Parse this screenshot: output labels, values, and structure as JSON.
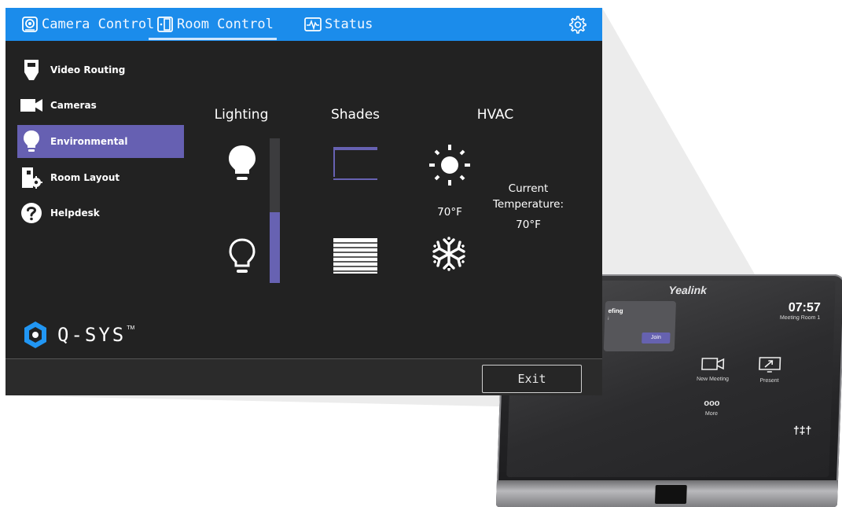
{
  "tabs": [
    {
      "label": "Camera Control",
      "icon": "camera-lens-icon"
    },
    {
      "label": "Room Control",
      "icon": "door-icon",
      "active": true
    },
    {
      "label": "Status",
      "icon": "waveform-icon"
    }
  ],
  "settings_icon": "gear-icon",
  "nav": [
    {
      "label": "Video Routing",
      "icon": "hdmi-connector-icon"
    },
    {
      "label": "Cameras",
      "icon": "video-camera-icon"
    },
    {
      "label": "Environmental",
      "icon": "lightbulb-icon",
      "active": true
    },
    {
      "label": "Room Layout",
      "icon": "room-layout-gear-icon"
    },
    {
      "label": "Helpdesk",
      "icon": "question-icon"
    }
  ],
  "environmental": {
    "lighting": {
      "title": "Lighting",
      "level": 0.49
    },
    "shades": {
      "title": "Shades"
    },
    "hvac": {
      "title": "HVAC",
      "setpoint": "70°F",
      "current_label": "Current Temperature:",
      "current_value": "70°F"
    }
  },
  "logo": {
    "text": "Q-SYS",
    "tm": "TM"
  },
  "footer": {
    "exit_label": "Exit"
  },
  "device": {
    "brand": "Yealink",
    "time": "07:57",
    "room": "Meeting Room 1",
    "card_title": "efing",
    "card_sub": "i",
    "join_label": "Join",
    "actions": [
      "New Meeting",
      "Present",
      "More"
    ],
    "more_dots": "ooo",
    "mixer_glyph": "†‡†"
  },
  "colors": {
    "accent_blue": "#1b8ceb",
    "accent_purple": "#6660b2",
    "panel_bg": "#222222"
  }
}
